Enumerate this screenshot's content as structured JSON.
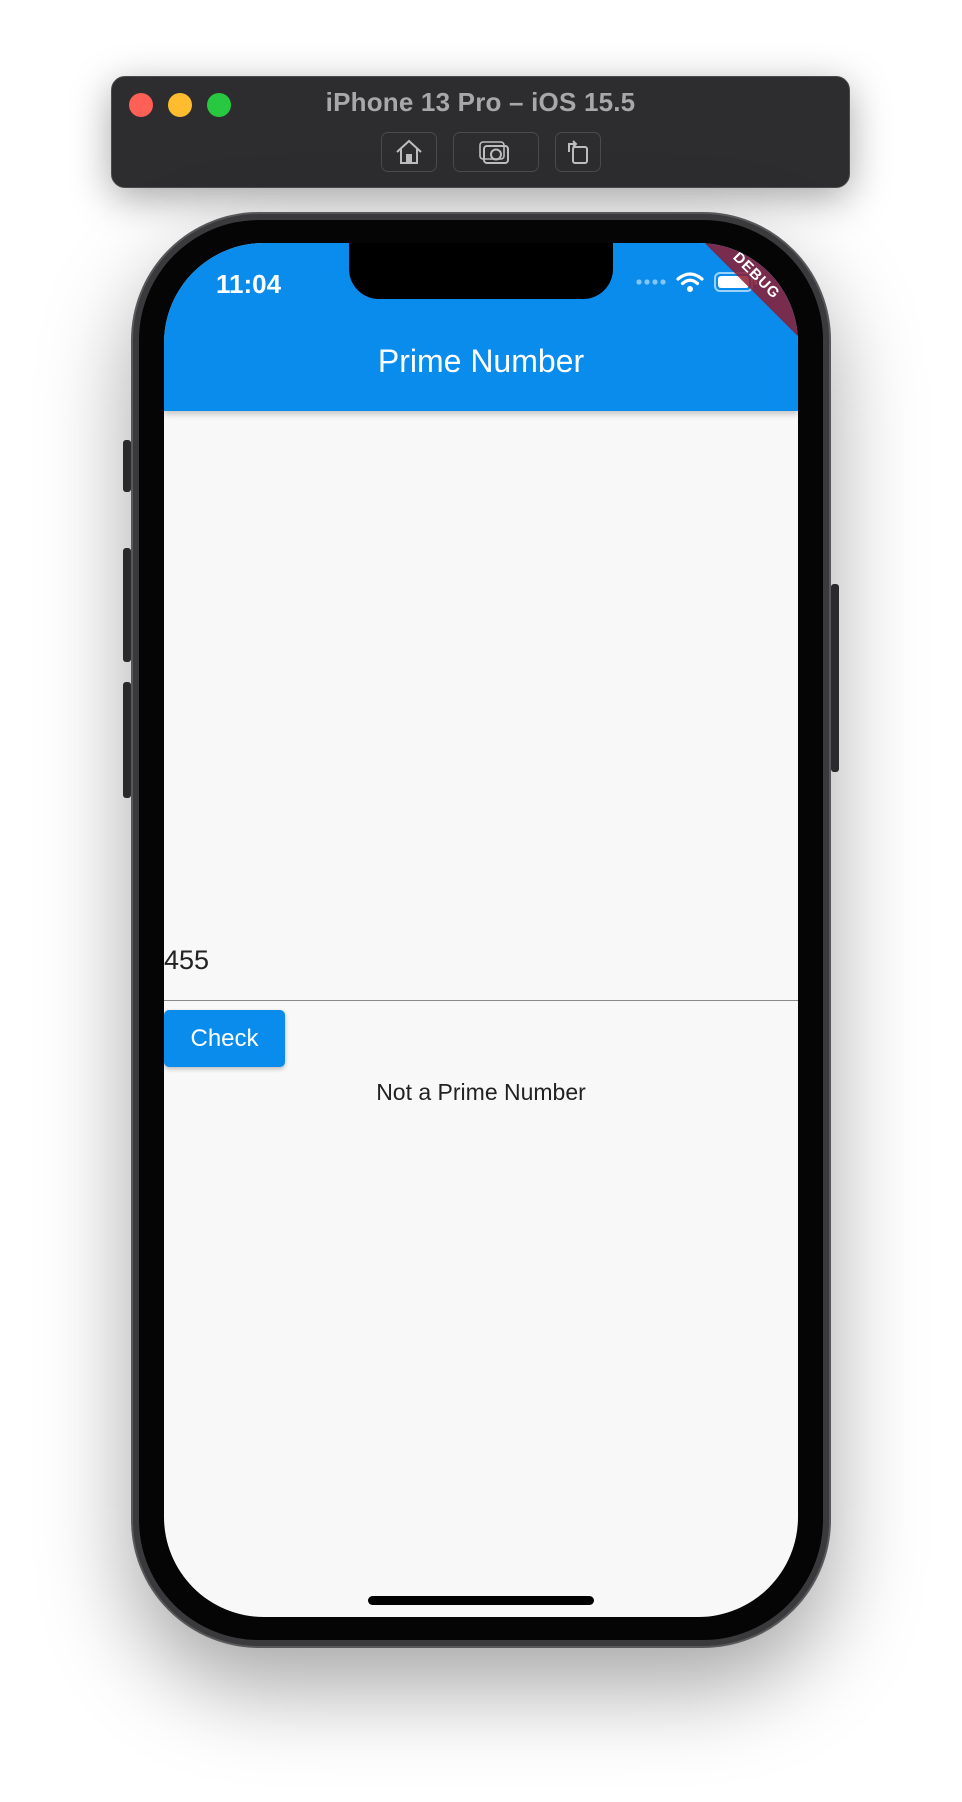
{
  "simulator": {
    "title": "iPhone 13 Pro – iOS 15.5",
    "buttons": [
      "home-icon",
      "screenshot-icon",
      "rotate-icon"
    ]
  },
  "status_bar": {
    "time": "11:04",
    "icons": [
      "signal-dots-icon",
      "wifi-icon",
      "battery-icon"
    ]
  },
  "debug_banner": "DEBUG",
  "app_bar": {
    "title": "Prime Number"
  },
  "form": {
    "input_value": "455",
    "button_label": "Check",
    "result": "Not a Prime Number"
  },
  "colors": {
    "primary": "#0a8ced",
    "background": "#f8f8f8",
    "debug": "#8c1c32"
  }
}
